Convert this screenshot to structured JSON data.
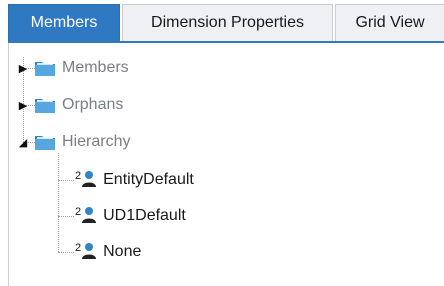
{
  "tabs": [
    {
      "label": "Members",
      "active": true
    },
    {
      "label": "Dimension Properties",
      "active": false
    },
    {
      "label": "Grid View",
      "active": false
    }
  ],
  "colors": {
    "active_tab": "#2f79c2",
    "folder": "#2e86c9",
    "muted_text": "#7a7f86"
  },
  "tree": {
    "members": {
      "label": "Members",
      "icon": "folder-icon",
      "expanded": false
    },
    "orphans": {
      "label": "Orphans",
      "icon": "folder-icon",
      "expanded": false
    },
    "hierarchy": {
      "label": "Hierarchy",
      "icon": "folder-icon",
      "expanded": true,
      "children": [
        {
          "label": "EntityDefault",
          "icon": "member-icon",
          "badge": "2"
        },
        {
          "label": "UD1Default",
          "icon": "member-icon",
          "badge": "2"
        },
        {
          "label": "None",
          "icon": "member-icon",
          "badge": "2"
        }
      ]
    }
  }
}
